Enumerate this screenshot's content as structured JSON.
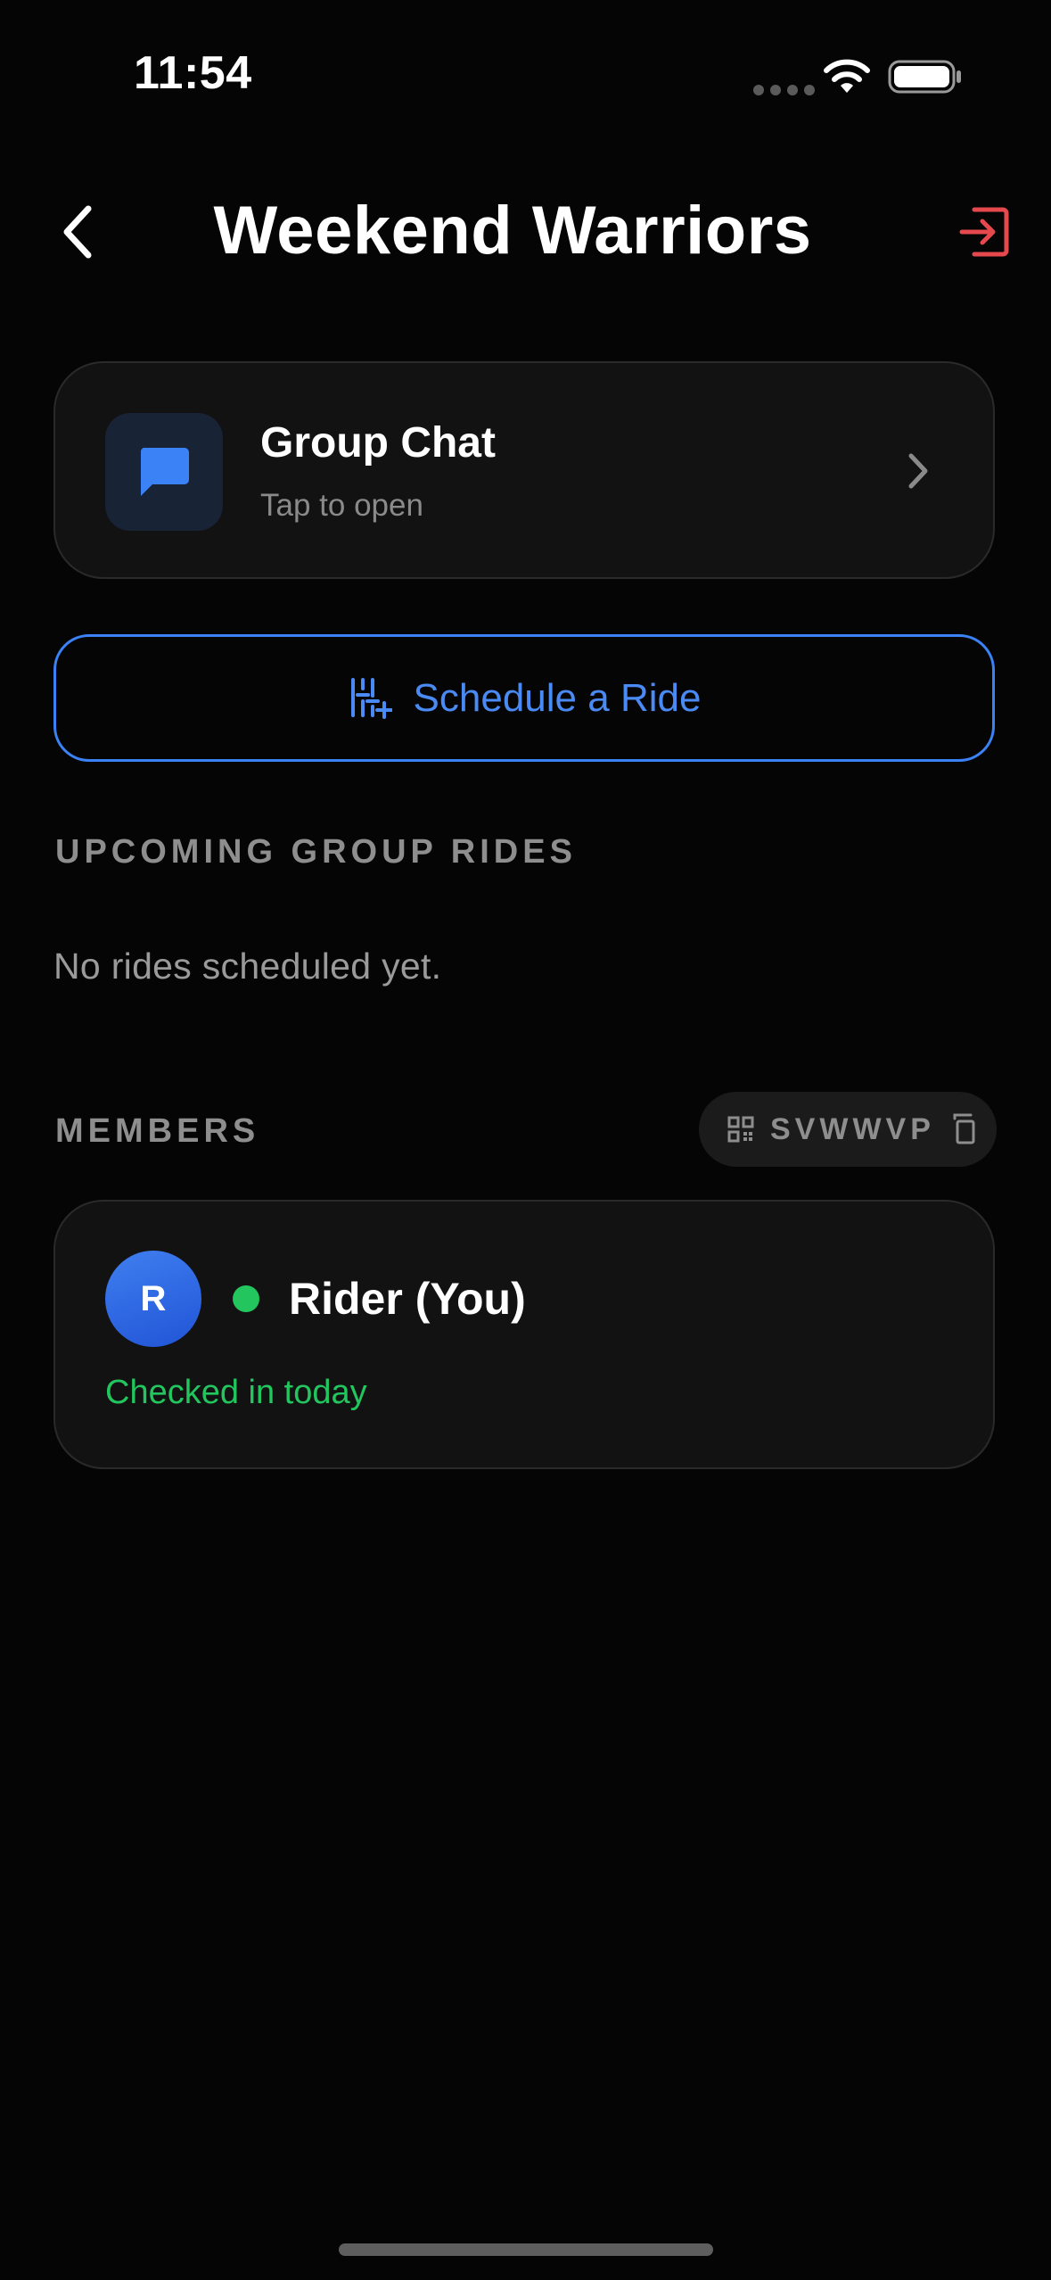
{
  "status_bar": {
    "time": "11:54",
    "icons": [
      "signal-dots-icon",
      "wifi-icon",
      "battery-icon"
    ]
  },
  "header": {
    "title": "Weekend Warriors",
    "back_icon": "chevron-left-icon",
    "leave_icon": "exit-icon"
  },
  "group_chat": {
    "title": "Group Chat",
    "subtitle": "Tap to open",
    "icon": "chat-bubble-icon"
  },
  "schedule": {
    "label": "Schedule a Ride",
    "icon": "schedule-sliders-icon"
  },
  "upcoming": {
    "heading": "UPCOMING GROUP RIDES",
    "empty_message": "No rides scheduled yet."
  },
  "members": {
    "heading": "MEMBERS",
    "invite_code": "SVWWVP",
    "items": [
      {
        "initial": "R",
        "name": "Rider (You)",
        "status": "Checked in today",
        "online": true
      }
    ]
  },
  "colors": {
    "background": "#050505",
    "card": "#121212",
    "accent_blue": "#3b82f6",
    "online_green": "#22c55e",
    "leave_red": "#e5484d",
    "muted_text": "#8e8e8e"
  }
}
